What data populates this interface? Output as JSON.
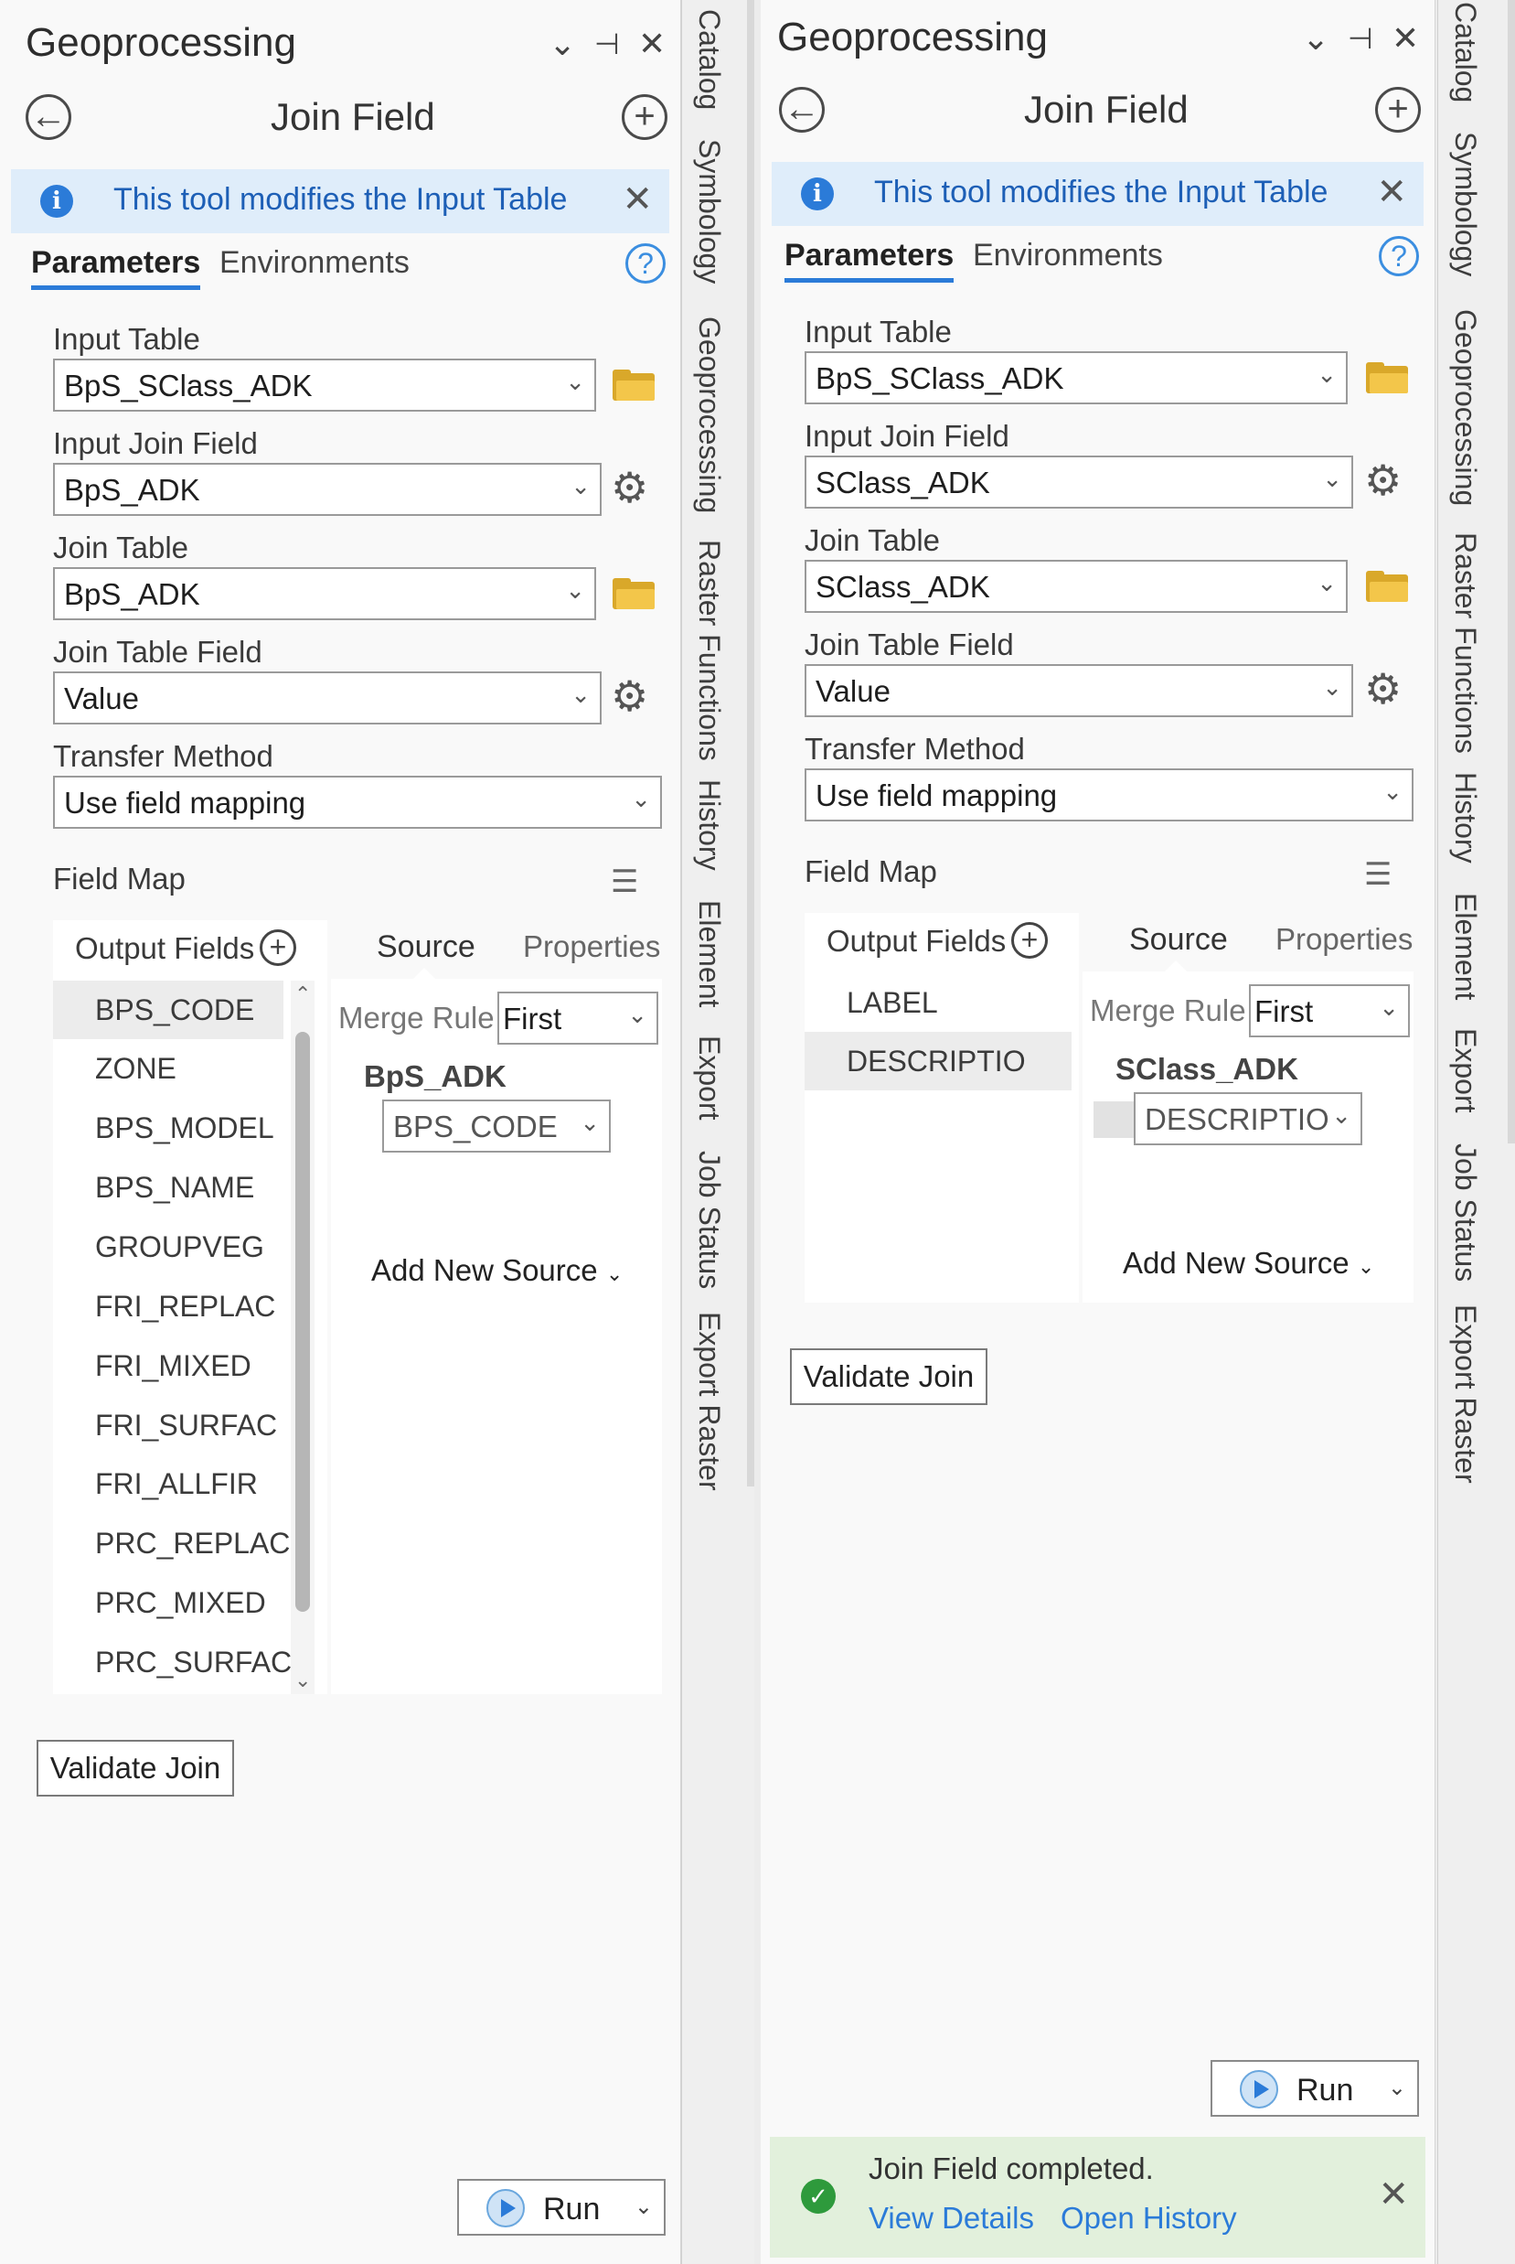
{
  "left": {
    "pane_title": "Geoprocessing",
    "tool_title": "Join Field",
    "banner_text": "This tool modifies the Input Table",
    "tabs": [
      "Parameters",
      "Environments"
    ],
    "fields": {
      "input_table_label": "Input Table",
      "input_table_value": "BpS_SClass_ADK",
      "input_join_field_label": "Input Join Field",
      "input_join_field_value": "BpS_ADK",
      "join_table_label": "Join Table",
      "join_table_value": "BpS_ADK",
      "join_table_field_label": "Join Table Field",
      "join_table_field_value": "Value",
      "transfer_method_label": "Transfer Method",
      "transfer_method_value": "Use field mapping"
    },
    "field_map": {
      "label": "Field Map",
      "output_fields_label": "Output Fields",
      "output_fields": [
        "BPS_CODE",
        "ZONE",
        "BPS_MODEL",
        "BPS_NAME",
        "GROUPVEG",
        "FRI_REPLAC",
        "FRI_MIXED",
        "FRI_SURFAC",
        "FRI_ALLFIR",
        "PRC_REPLAC",
        "PRC_MIXED",
        "PRC_SURFAC"
      ],
      "selected_field": "BPS_CODE",
      "source_tab": "Source",
      "properties_tab": "Properties",
      "merge_rule_label": "Merge Rule",
      "merge_rule_value": "First",
      "source_table": "BpS_ADK",
      "source_field": "BPS_CODE",
      "add_new_source": "Add New Source"
    },
    "validate_label": "Validate Join",
    "run_label": "Run"
  },
  "right": {
    "pane_title": "Geoprocessing",
    "tool_title": "Join Field",
    "banner_text": "This tool modifies the Input Table",
    "tabs": [
      "Parameters",
      "Environments"
    ],
    "fields": {
      "input_table_label": "Input Table",
      "input_table_value": "BpS_SClass_ADK",
      "input_join_field_label": "Input Join Field",
      "input_join_field_value": "SClass_ADK",
      "join_table_label": "Join Table",
      "join_table_value": "SClass_ADK",
      "join_table_field_label": "Join Table Field",
      "join_table_field_value": "Value",
      "transfer_method_label": "Transfer Method",
      "transfer_method_value": "Use field mapping"
    },
    "field_map": {
      "label": "Field Map",
      "output_fields_label": "Output Fields",
      "output_fields": [
        "LABEL",
        "DESCRIPTIO"
      ],
      "selected_field": "DESCRIPTIO",
      "source_tab": "Source",
      "properties_tab": "Properties",
      "merge_rule_label": "Merge Rule",
      "merge_rule_value": "First",
      "source_table": "SClass_ADK",
      "source_field": "DESCRIPTIO",
      "add_new_source": "Add New Source"
    },
    "validate_label": "Validate Join",
    "run_label": "Run",
    "completion": {
      "message": "Join Field completed.",
      "view_details": "View Details",
      "open_history": "Open History"
    }
  },
  "side_tabs": [
    "Catalog",
    "Symbology",
    "Geoprocessing",
    "Raster Functions",
    "History",
    "Element",
    "Export",
    "Job Status",
    "Export Raster"
  ],
  "icons": {
    "back": "back-arrow-icon",
    "add": "add-icon",
    "info": "info-icon",
    "close": "close-icon",
    "help": "help-icon",
    "folder": "folder-icon",
    "gear": "gear-icon",
    "pin": "pin-icon",
    "options": "chevron-down-icon",
    "success": "check-circle-icon"
  },
  "colors": {
    "accent": "#2b7bd8",
    "banner_bg": "#dfedfa",
    "success_bg": "#e2f0dc",
    "folder": "#f3c64a"
  }
}
